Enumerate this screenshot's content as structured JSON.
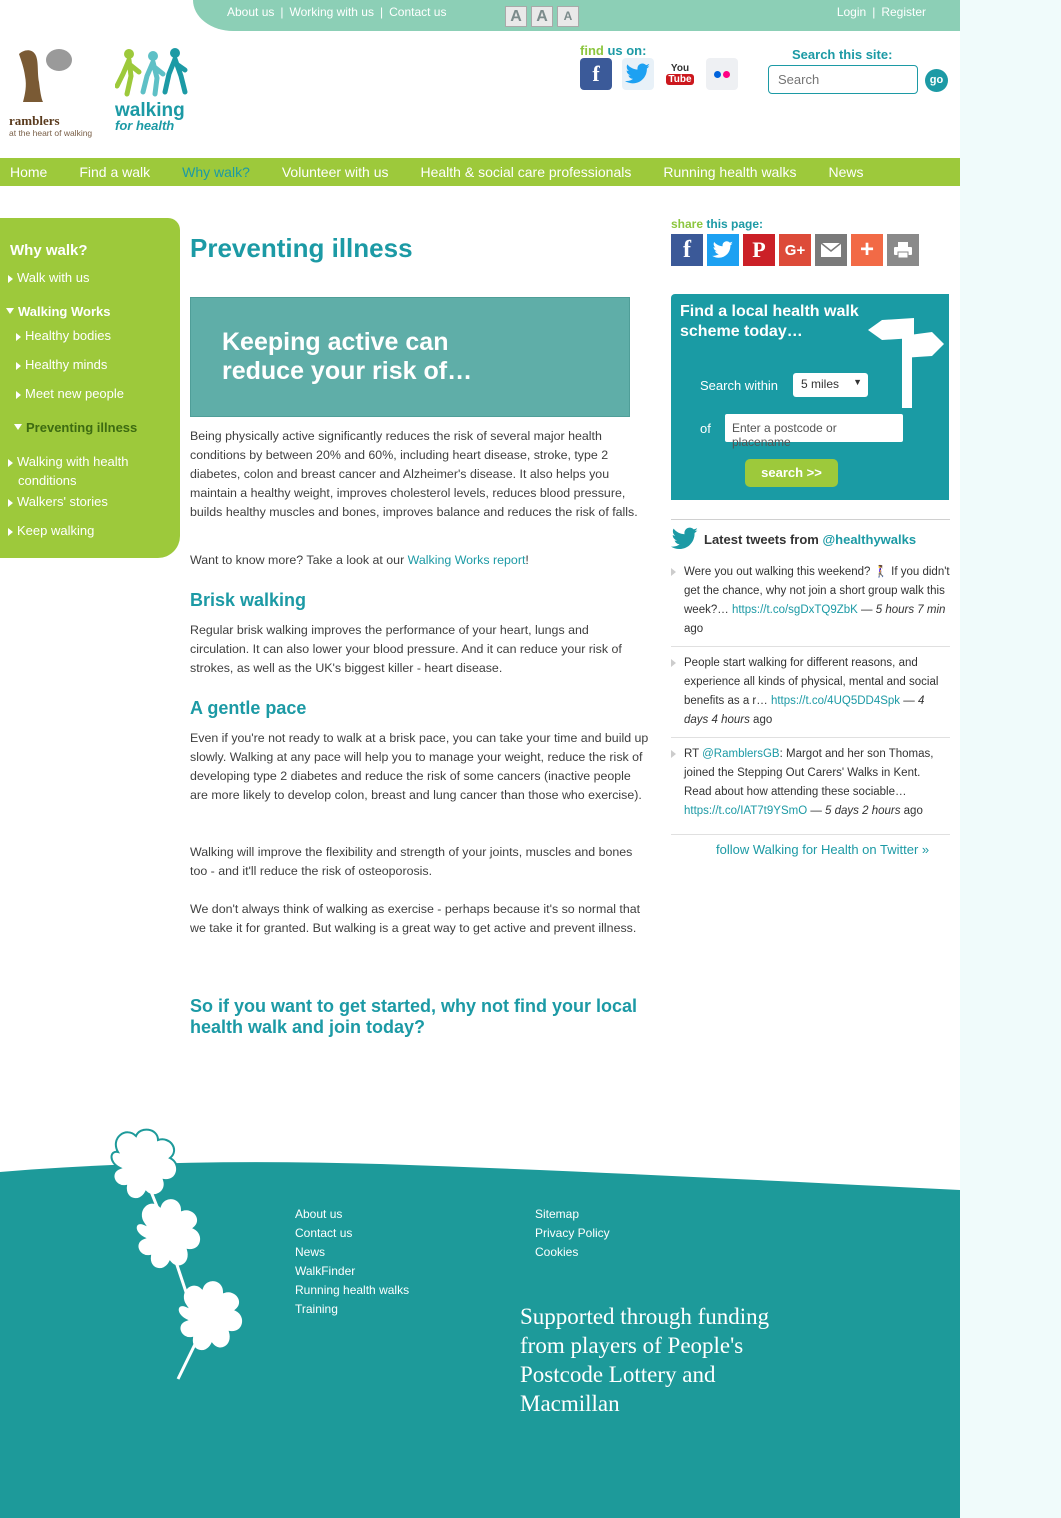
{
  "topbar": {
    "links": [
      "About us",
      "Working with us",
      "Contact us"
    ],
    "separator": "|",
    "font_size_buttons": [
      "A",
      "A",
      "A"
    ],
    "account_links": [
      "Login",
      "Register"
    ]
  },
  "logos": {
    "ramblers_name": "ramblers",
    "ramblers_tagline": "at the heart of walking",
    "wfh_line1": "walking",
    "wfh_line2": "for health"
  },
  "findus": {
    "prefix": "find",
    "middle": " us ",
    "suffix": "on:",
    "icons": [
      "facebook-icon",
      "twitter-icon",
      "youtube-icon",
      "flickr-icon"
    ],
    "youtube_you": "You",
    "youtube_tube": "Tube",
    "facebook_glyph": "f"
  },
  "search": {
    "label": "Search this site:",
    "placeholder": "Search",
    "go_label": "go"
  },
  "nav": {
    "items": [
      "Home",
      "Find a walk",
      "Why walk?",
      "Volunteer with us",
      "Health & social care professionals",
      "Running health walks",
      "News"
    ],
    "active_index": 2
  },
  "sidebar": {
    "title": "Why walk?",
    "items": [
      {
        "label": "Walk with us"
      },
      {
        "label": "Walking Works"
      },
      {
        "label": "Healthy bodies"
      },
      {
        "label": "Healthy minds"
      },
      {
        "label": "Meet new people"
      },
      {
        "label": "Preventing illness"
      },
      {
        "label": "Walking with health conditions"
      },
      {
        "label": "Walkers' stories"
      },
      {
        "label": "Keep walking"
      }
    ]
  },
  "main": {
    "title": "Preventing illness",
    "banner": "Keeping active can reduce your risk of…",
    "intro": "Being physically active significantly reduces the risk of several major health conditions by between 20% and 60%, including heart disease, stroke, type 2 diabetes, colon and breast cancer and Alzheimer's disease. It also helps you maintain a healthy weight, improves cholesterol levels, reduces blood pressure, builds healthy muscles and bones, improves balance and reduces the risk of falls.",
    "more_prefix": "Want to know more? Take a look at our ",
    "more_link": "Walking Works report",
    "more_suffix": "!",
    "brisk_heading": "Brisk walking",
    "brisk_text": "Regular brisk walking improves the performance of your heart, lungs and circulation. It can also lower your blood pressure. And it can reduce your risk of strokes, as well as the UK's biggest killer - heart disease.",
    "gentle_heading": "A gentle pace",
    "gentle_p1": "Even if you're not ready to walk at a brisk pace, you can take your time and build up slowly. Walking at any pace will help you to manage your weight, reduce the risk of developing type 2 diabetes and reduce the risk of some cancers (inactive people are more likely to develop colon, breast and lung cancer than those who exercise).",
    "gentle_p2": "Walking will improve the flexibility and strength of your joints, muscles and bones too - and it'll reduce the risk of osteoporosis.",
    "gentle_p3": "We don't always think of walking as exercise - perhaps because it's so normal that we take it for granted. But walking is a great way to get active and prevent illness.",
    "cta": "So if you want to get started, why not find your local health walk and join today?"
  },
  "share": {
    "label_prefix": "share",
    "label_middle": " this ",
    "label_suffix": "page:",
    "buttons": [
      {
        "icon": "facebook-icon",
        "glyph": "f",
        "color": "#3b5998"
      },
      {
        "icon": "twitter-icon",
        "glyph": "",
        "color": "#1da1f2"
      },
      {
        "icon": "pinterest-icon",
        "glyph": "P",
        "color": "#cb2027"
      },
      {
        "icon": "googleplus-icon",
        "glyph": "G+",
        "color": "#dd4b39"
      },
      {
        "icon": "email-icon",
        "glyph": "",
        "color": "#7a7a7a"
      },
      {
        "icon": "more-icon",
        "glyph": "+",
        "color": "#f26a46"
      },
      {
        "icon": "print-icon",
        "glyph": "",
        "color": "#8a8a8a"
      }
    ]
  },
  "findwalk": {
    "title": "Find a local health walk scheme today…",
    "search_within_label": "Search within",
    "distance_value": "5 miles",
    "of_label": "of",
    "postcode_placeholder": "Enter a postcode or placename",
    "button_label": "search >>"
  },
  "tweets": {
    "heading_prefix": "Latest tweets from ",
    "handle": "@healthywalks",
    "items": [
      {
        "text": "Were you out walking this weekend? 🚶‍♀️ If you didn't get the chance, why not join a short group walk this week?… ",
        "link": "https://t.co/sgDxTQ9ZbK",
        "time": "5 hours 7 min",
        "ago": " ago"
      },
      {
        "text": "People start walking for different reasons, and experience all kinds of physical, mental and social benefits as a r… ",
        "link": "https://t.co/4UQ5DD4Spk",
        "time": "4 days 4 hours",
        "ago": " ago"
      },
      {
        "text_prefix": "RT ",
        "mention": "@RamblersGB",
        "text": ": Margot and her son Thomas, joined the Stepping Out Carers' Walks in Kent. Read about how attending these sociable… ",
        "link": "https://t.co/IAT7t9YSmO",
        "time": "5 days 2 hours",
        "ago": " ago"
      }
    ],
    "dash": " — ",
    "follow": "follow Walking for Health on Twitter »"
  },
  "footer": {
    "col1": [
      "About us",
      "Contact us",
      "News",
      "WalkFinder",
      "Running health walks",
      "Training"
    ],
    "col2": [
      "Sitemap",
      "Privacy Policy",
      "Cookies"
    ],
    "support": "Supported through funding from players of People's Postcode Lottery and Macmillan",
    "colors": {
      "teal": "#1d9a9a",
      "green": "#9dc93b",
      "brand_teal": "#1c9aa5"
    }
  }
}
